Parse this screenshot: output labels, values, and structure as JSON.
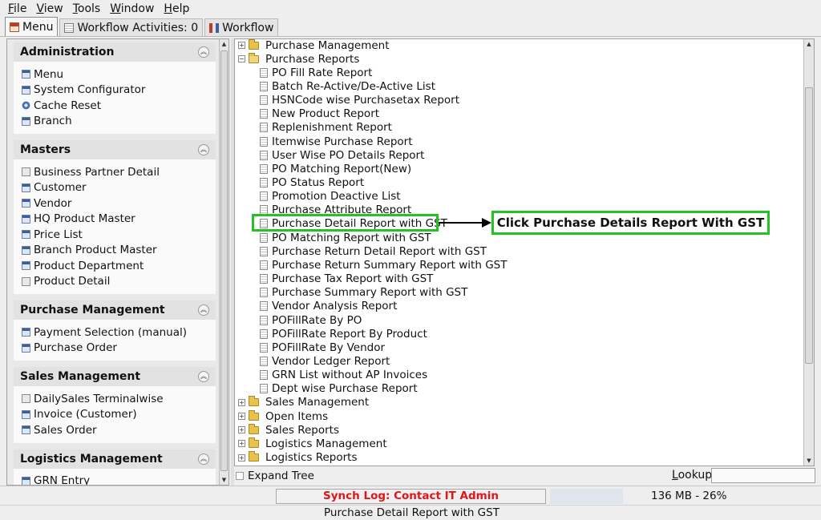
{
  "menubar": [
    {
      "label": "File",
      "key": "F",
      "rest": "ile"
    },
    {
      "label": "View",
      "key": "V",
      "rest": "iew"
    },
    {
      "label": "Tools",
      "key": "T",
      "rest": "ools"
    },
    {
      "label": "Window",
      "key": "W",
      "rest": "indow"
    },
    {
      "label": "Help",
      "key": "H",
      "rest": "elp"
    }
  ],
  "tabs": [
    {
      "label": "Menu",
      "icon": "home-icon",
      "active": true
    },
    {
      "label": "Workflow Activities: 0",
      "icon": "table-icon",
      "active": false
    },
    {
      "label": "Workflow",
      "icon": "workflow-icon",
      "active": false
    }
  ],
  "sections": [
    {
      "title": "Administration",
      "items": [
        {
          "label": "Menu",
          "icon": "window-icon"
        },
        {
          "label": "System Configurator",
          "icon": "window-icon"
        },
        {
          "label": "Cache Reset",
          "icon": "gear-icon"
        },
        {
          "label": "Branch",
          "icon": "window-icon"
        }
      ]
    },
    {
      "title": "Masters",
      "items": [
        {
          "label": "Business Partner Detail",
          "icon": "box-icon"
        },
        {
          "label": "Customer",
          "icon": "window-icon"
        },
        {
          "label": "Vendor",
          "icon": "window-icon"
        },
        {
          "label": "HQ Product Master",
          "icon": "window-icon"
        },
        {
          "label": "Price List",
          "icon": "window-icon"
        },
        {
          "label": "Branch Product Master",
          "icon": "window-icon"
        },
        {
          "label": "Product Department",
          "icon": "window-icon"
        },
        {
          "label": "Product Detail",
          "icon": "box-icon"
        }
      ]
    },
    {
      "title": "Purchase Management",
      "items": [
        {
          "label": "Payment Selection (manual)",
          "icon": "window-icon"
        },
        {
          "label": "Purchase Order",
          "icon": "window-icon"
        }
      ]
    },
    {
      "title": "Sales Management",
      "items": [
        {
          "label": "DailySales Terminalwise",
          "icon": "box-icon"
        },
        {
          "label": "Invoice (Customer)",
          "icon": "window-icon"
        },
        {
          "label": "Sales Order",
          "icon": "window-icon"
        }
      ]
    },
    {
      "title": "Logistics Management",
      "items": [
        {
          "label": "GRN Entry",
          "icon": "window-icon"
        }
      ]
    }
  ],
  "tree": {
    "top_folders": [
      {
        "label": "Purchase Management",
        "expanded": false
      },
      {
        "label": "Purchase Reports",
        "expanded": true
      }
    ],
    "reports": [
      "PO Fill Rate Report",
      "Batch Re-Active/De-Active List",
      "HSNCode wise Purchasetax Report",
      "New Product Report",
      "Replenishment Report",
      "Itemwise Purchase Report",
      "User Wise PO Details Report",
      "PO Matching Report(New)",
      "PO Status Report",
      "Promotion Deactive List",
      "Purchase Attribute Report",
      "Purchase Detail Report with GST",
      "PO Matching Report with GST",
      "Purchase Return Detail Report with GST",
      "Purchase Return Summary Report with GST",
      "Purchase Tax Report with GST",
      "Purchase Summary Report with GST",
      "Vendor Analysis Report",
      "POFillRate By PO",
      "POFillRate Report By Product",
      "POFillRate By Vendor",
      "Vendor Ledger Report",
      "GRN List without AP Invoices",
      "Dept wise Purchase Report"
    ],
    "bottom_folders": [
      "Sales Management",
      "Open Items",
      "Sales Reports",
      "Logistics Management",
      "Logistics Reports"
    ]
  },
  "callout": {
    "text": "Click Purchase Details Report With GST",
    "color": "#22c322"
  },
  "below": {
    "expand_tree": "Expand Tree",
    "lookup_label": "Lookup",
    "lookup_key": "L",
    "lookup_rest": "ookup",
    "lookup_value": ""
  },
  "status": {
    "synch": "Synch Log: Contact IT Admin",
    "memory": "136 MB - 26%",
    "footer": "Purchase Detail Report with GST"
  }
}
